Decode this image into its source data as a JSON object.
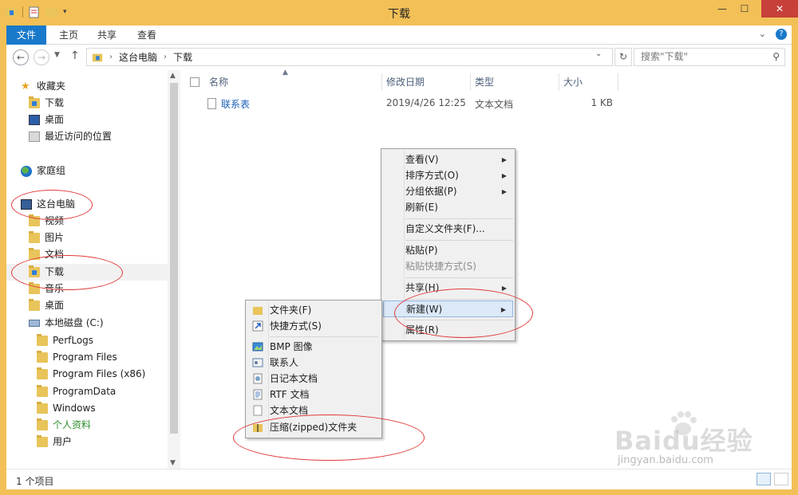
{
  "window": {
    "title": "下载",
    "controls": {
      "minimize": "—",
      "maximize": "☐",
      "close": "✕"
    }
  },
  "ribbon": {
    "tabs": [
      {
        "label": "文件"
      },
      {
        "label": "主页"
      },
      {
        "label": "共享"
      },
      {
        "label": "查看"
      }
    ],
    "help": "?"
  },
  "address": {
    "segments": [
      "这台电脑",
      "下载"
    ],
    "search_placeholder": "搜索\"下载\""
  },
  "nav": {
    "favorites": "收藏夹",
    "fav_items": [
      "下载",
      "桌面",
      "最近访问的位置"
    ],
    "homegroup": "家庭组",
    "thispc": "这台电脑",
    "pc_items": [
      "视频",
      "图片",
      "文档",
      "下载",
      "音乐",
      "桌面"
    ],
    "drive": "本地磁盘 (C:)",
    "drive_items": [
      "PerfLogs",
      "Program Files",
      "Program Files (x86)",
      "ProgramData",
      "Windows",
      "个人资料",
      "用户"
    ]
  },
  "filelist": {
    "columns": {
      "name": "名称",
      "date": "修改日期",
      "type": "类型",
      "size": "大小"
    },
    "files": [
      {
        "name": "联系表",
        "date": "2019/4/26 12:25",
        "type": "文本文档",
        "size": "1 KB"
      }
    ]
  },
  "context_menu": {
    "items": [
      {
        "label": "查看(V)"
      },
      {
        "label": "排序方式(O)"
      },
      {
        "label": "分组依据(P)"
      },
      {
        "label": "刷新(E)"
      },
      {
        "label": "自定义文件夹(F)..."
      },
      {
        "label": "粘贴(P)"
      },
      {
        "label": "粘贴快捷方式(S)"
      },
      {
        "label": "共享(H)"
      },
      {
        "label": "新建(W)"
      },
      {
        "label": "属性(R)"
      }
    ]
  },
  "new_submenu": {
    "items": [
      {
        "label": "文件夹(F)",
        "icon": "folder-icon"
      },
      {
        "label": "快捷方式(S)",
        "icon": "shortcut-icon"
      },
      {
        "label": "BMP 图像",
        "icon": "bitmap-icon"
      },
      {
        "label": "联系人",
        "icon": "contact-icon"
      },
      {
        "label": "日记本文档",
        "icon": "journal-icon"
      },
      {
        "label": "RTF 文档",
        "icon": "rtf-icon"
      },
      {
        "label": "文本文档",
        "icon": "text-file-icon"
      },
      {
        "label": "压缩(zipped)文件夹",
        "icon": "zip-folder-icon"
      }
    ]
  },
  "status": {
    "count": "1 个项目"
  },
  "watermark": {
    "logo": "Baidu经验",
    "url": "jingyan.baidu.com"
  },
  "colors": {
    "accent": "#1979ca",
    "frame": "#f2c057",
    "annotation": "#e03a3a"
  }
}
